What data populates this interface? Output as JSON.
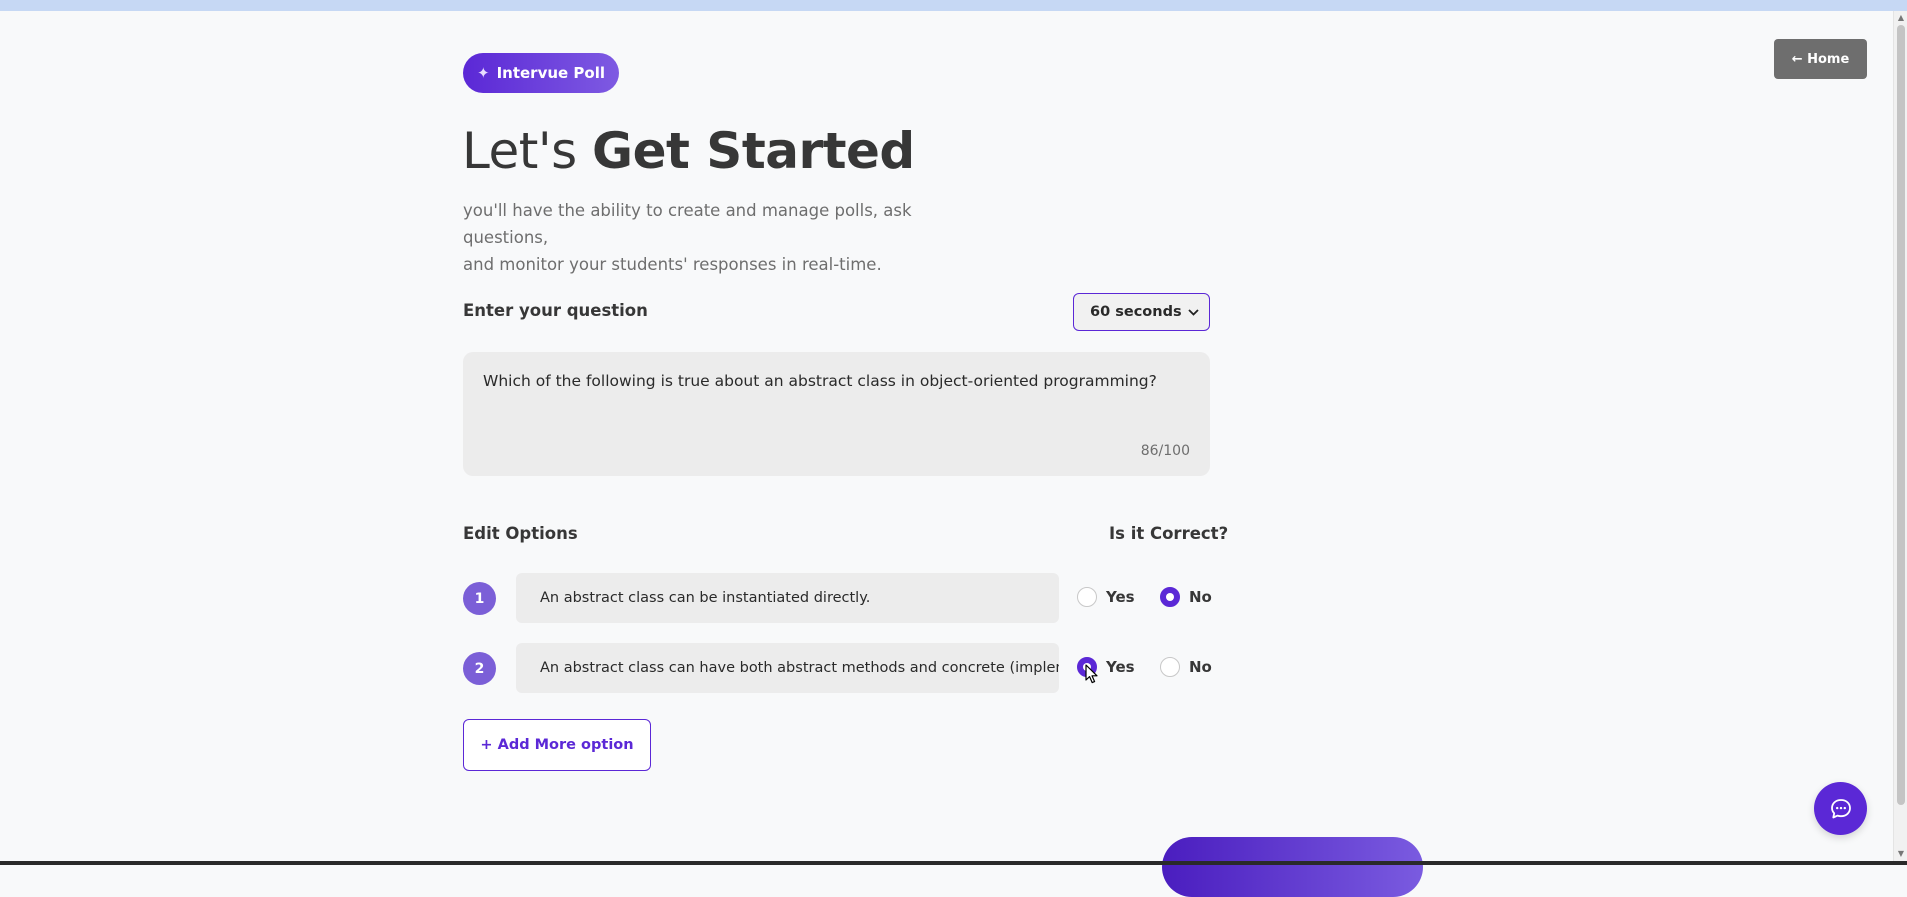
{
  "brand": {
    "label": "Intervue Poll",
    "icon": "sparkle-icon"
  },
  "nav": {
    "home_label": "← Home"
  },
  "hero": {
    "title_light": "Let's",
    "title_bold": "Get Started",
    "subtitle_line1": "you'll have the ability to create and manage polls, ask questions,",
    "subtitle_line2": "and monitor your students' responses in real-time."
  },
  "question": {
    "label": "Enter your question",
    "timer_value": "60 seconds",
    "text": "Which of the following is true about an abstract class in object-oriented programming?",
    "char_count": "86/100"
  },
  "options_section": {
    "label": "Edit Options",
    "correct_label": "Is it Correct?",
    "yes_label": "Yes",
    "no_label": "No",
    "options": [
      {
        "number": "1",
        "text": "An abstract class can be instantiated directly.",
        "correct": "No"
      },
      {
        "number": "2",
        "text": "An abstract class can have both abstract methods and concrete (implemen",
        "correct": "Yes"
      }
    ],
    "add_label": "+ Add More option"
  },
  "colors": {
    "accent": "#5b28d6",
    "accent_light": "#7e5ae2",
    "badge": "#7b5fd7",
    "home_button": "#6e6e6e"
  },
  "icons": {
    "chat": "chat-bubble-icon",
    "cursor": "cursor-pointer-icon"
  }
}
